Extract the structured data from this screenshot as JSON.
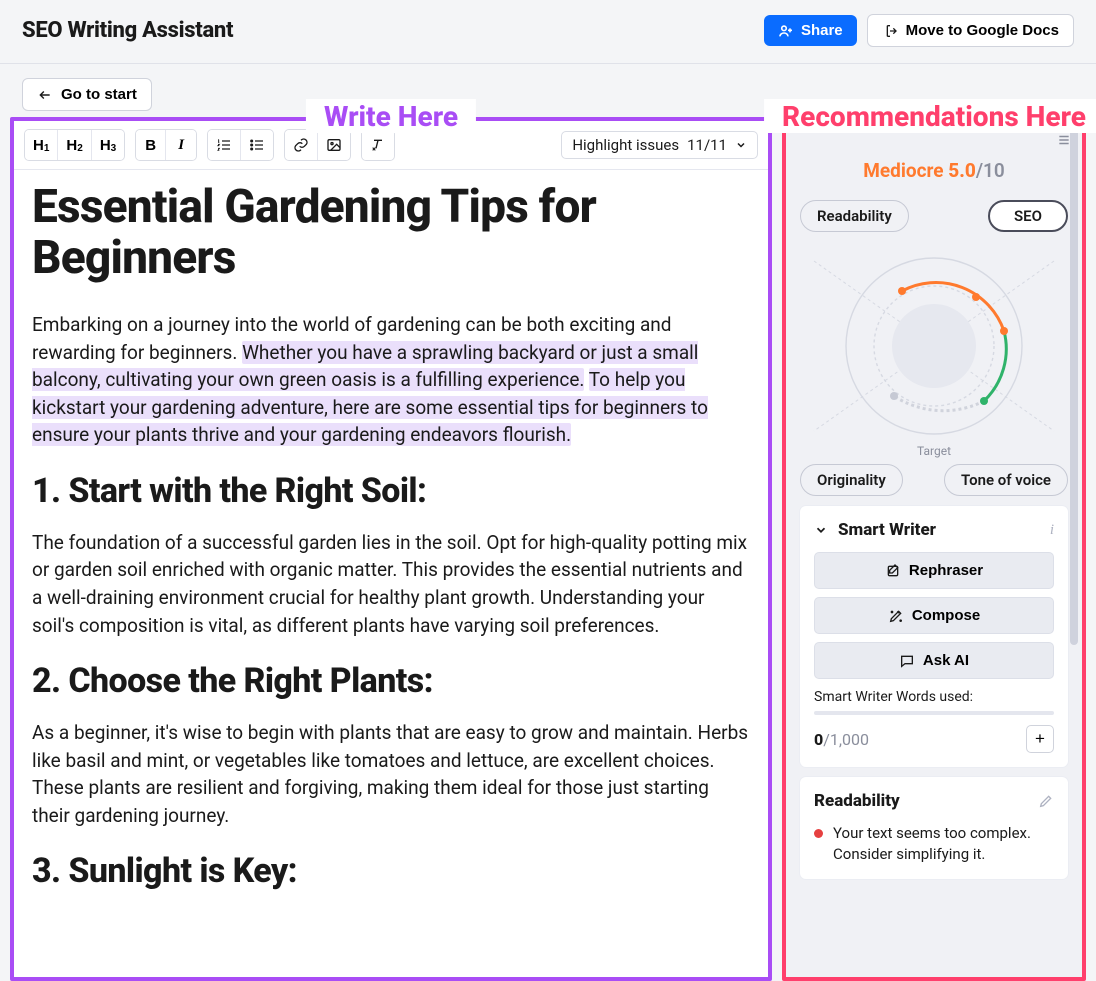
{
  "app_title": "SEO Writing Assistant",
  "buttons": {
    "share": "Share",
    "gdocs": "Move to Google Docs",
    "goto_start": "Go to start"
  },
  "toolbar": {
    "h1": "H",
    "h1_sub": "1",
    "h2": "H",
    "h2_sub": "2",
    "h3": "H",
    "h3_sub": "3",
    "bold": "B",
    "italic": "I",
    "highlight_label": "Highlight issues",
    "highlight_count": "11/11"
  },
  "frames": {
    "write": "Write Here",
    "recs": "Recommendations Here"
  },
  "doc": {
    "title": "Essential Gardening Tips for Beginners",
    "p1_plain1": "Embarking on a journey into the world of gardening can be both exciting and rewarding for beginners. ",
    "p1_hl1": "Whether you have a sprawling backyard or just a small balcony, cultivating your own green oasis is a fulfilling experience.",
    "p1_plain2": " ",
    "p1_hl2": "To help you kickstart your gardening adventure, here are some essential tips for beginners to ensure your plants thrive and your gardening endeavors flourish.",
    "h2_1": "1. Start with the Right Soil:",
    "p2": "The foundation of a successful garden lies in the soil. Opt for high-quality potting mix or garden soil enriched with organic matter. This provides the essential nutrients and a well-draining environment crucial for healthy plant growth. Understanding your soil's composition is vital, as different plants have varying soil preferences.",
    "h2_2": "2. Choose the Right Plants:",
    "p3": "As a beginner, it's wise to begin with plants that are easy to grow and maintain. Herbs like basil and mint, or vegetables like tomatoes and lettuce, are excellent choices. These plants are resilient and forgiving, making them ideal for those just starting their gardening journey.",
    "h2_3": "3. Sunlight is Key:"
  },
  "score": {
    "label": "Mediocre",
    "value": "5.0",
    "max": "/10",
    "target": "Target"
  },
  "chips": {
    "readability": "Readability",
    "seo": "SEO",
    "originality": "Originality",
    "tone": "Tone of voice"
  },
  "smart_writer": {
    "title": "Smart Writer",
    "rephraser": "Rephraser",
    "compose": "Compose",
    "ask_ai": "Ask AI",
    "usage_label": "Smart Writer Words used:",
    "usage_used": "0",
    "usage_max": "/1,000"
  },
  "readability_card": {
    "title": "Readability",
    "msg": "Your text seems too complex. Consider simplifying it."
  },
  "chart_data": {
    "type": "radar",
    "axes": [
      "Readability",
      "SEO",
      "Tone of voice",
      "Originality"
    ],
    "target": [
      1.0,
      1.0,
      1.0,
      1.0
    ],
    "current": [
      0.35,
      0.85,
      0.85,
      0.35
    ],
    "score": 5.0,
    "score_max": 10
  }
}
